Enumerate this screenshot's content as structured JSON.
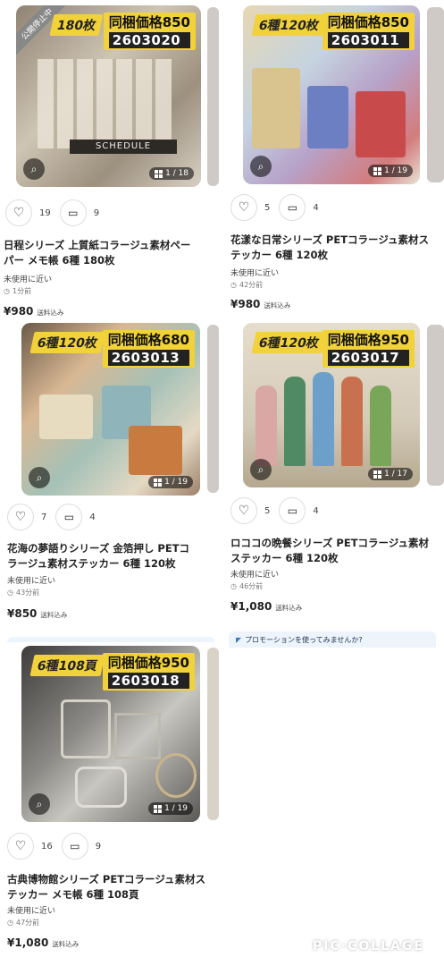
{
  "cards": [
    {
      "count_label": "180枚",
      "price_label": "同梱価格850",
      "code": "2603020",
      "sash": "公開停止中",
      "pager": "1 / 18",
      "likes": "19",
      "comments": "9",
      "title": "日程シリーズ 上質紙コラージュ素材ペー\nパー メモ帳 6種 180枚",
      "condition": "未使用に近い",
      "time": "1分前",
      "price": "¥980",
      "shipping": "送料込み",
      "image_theme": "#b9ad9c"
    },
    {
      "count_label": "6種120枚",
      "price_label": "同梱価格850",
      "code": "2603011",
      "pager": "1 / 19",
      "likes": "5",
      "comments": "4",
      "title": "花漾な日常シリーズ PETコラージュ素材ス\nテッカー 6種 120枚",
      "condition": "未使用に近い",
      "time": "42分前",
      "price": "¥980",
      "shipping": "送料込み",
      "image_theme": "#9fb6c8"
    },
    {
      "count_label": "6種120枚",
      "price_label": "同梱価格680",
      "code": "2603013",
      "pager": "1 / 19",
      "likes": "7",
      "comments": "4",
      "title": "花海の夢語りシリーズ 金箔押し PETコ\nラージュ素材ステッカー 6種 120枚",
      "condition": "未使用に近い",
      "time": "43分前",
      "price": "¥850",
      "shipping": "送料込み",
      "image_theme": "#b8a48c"
    },
    {
      "count_label": "6種120枚",
      "price_label": "同梱価格950",
      "code": "2603017",
      "pager": "1 / 17",
      "likes": "5",
      "comments": "4",
      "title": "ロココの晩餐シリーズ PETコラージュ素材\nステッカー 6種 120枚",
      "condition": "未使用に近い",
      "time": "46分前",
      "price": "¥1,080",
      "shipping": "送料込み",
      "image_theme": "#c9c0ad"
    },
    {
      "count_label": "6種108頁",
      "price_label": "同梱価格950",
      "code": "2603018",
      "pager": "1 / 19",
      "likes": "16",
      "comments": "9",
      "title": "古典博物館シリーズ PETコラージュ素材ス\nテッカー メモ帳 6種 108頁",
      "condition": "未使用に近い",
      "time": "47分前",
      "price": "¥1,080",
      "shipping": "送料込み",
      "image_theme": "#6d6c6a"
    }
  ],
  "promo": {
    "text": "プロモーションを使ってみませんか?"
  },
  "watermark": "PIC·COLLAGE",
  "colors": {
    "badge_yellow": "#f2d23a",
    "text": "#222222",
    "muted": "#777777"
  },
  "icons": [
    "heart-icon",
    "comment-icon",
    "lens-icon",
    "grid-icon",
    "clock-icon"
  ]
}
